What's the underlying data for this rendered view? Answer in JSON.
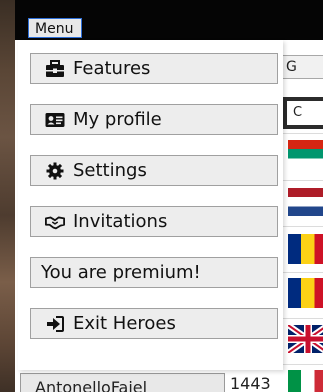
{
  "menu_label": "Menu",
  "dropdown": {
    "items": [
      {
        "label": "Features",
        "icon": "briefcase-icon"
      },
      {
        "label": "My profile",
        "icon": "id-card-icon"
      },
      {
        "label": "Settings",
        "icon": "gear-icon"
      },
      {
        "label": "Invitations",
        "icon": "handshake-icon"
      },
      {
        "label": "You are premium!",
        "icon": ""
      },
      {
        "label": "Exit Heroes",
        "icon": "sign-out-icon"
      }
    ]
  },
  "background": {
    "button_g_label": "G",
    "button_c_label": "C",
    "row_name": "AntonelloFaiel",
    "row_number": "1443"
  },
  "colors": {
    "menu_tab_border": "#2e6fd8",
    "menu_button_bg": "#ededed",
    "top_bar": "#050505"
  }
}
